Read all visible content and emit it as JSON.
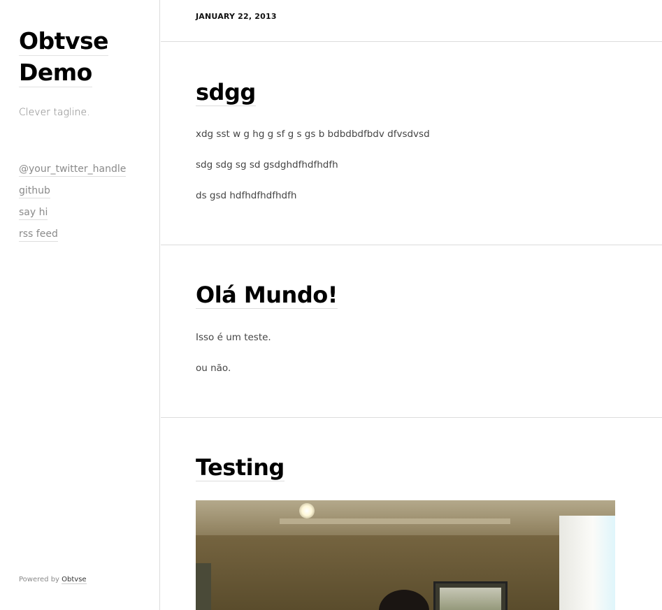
{
  "sidebar": {
    "title": "Obtvse Demo",
    "tagline": "Clever tagline.",
    "links": [
      "@your_twitter_handle",
      "github",
      "say hi",
      "rss feed"
    ],
    "powered_prefix": "Powered by",
    "powered_link": "Obtvse"
  },
  "header": {
    "date": "JANUARY 22, 2013"
  },
  "posts": [
    {
      "title": "sdgg",
      "paragraphs": [
        "xdg sst w g hg g sf g s gs b bdbdbdfbdv dfvsdvsd",
        "sdg sdg sg sd gsdghdfhdfhdfh",
        "ds gsd hdfhdfhdfhdfh"
      ]
    },
    {
      "title": "Olá Mundo!",
      "paragraphs": [
        "Isso é um teste.",
        "ou não."
      ]
    },
    {
      "title": "Testing",
      "image": "photo of a room interior"
    }
  ]
}
